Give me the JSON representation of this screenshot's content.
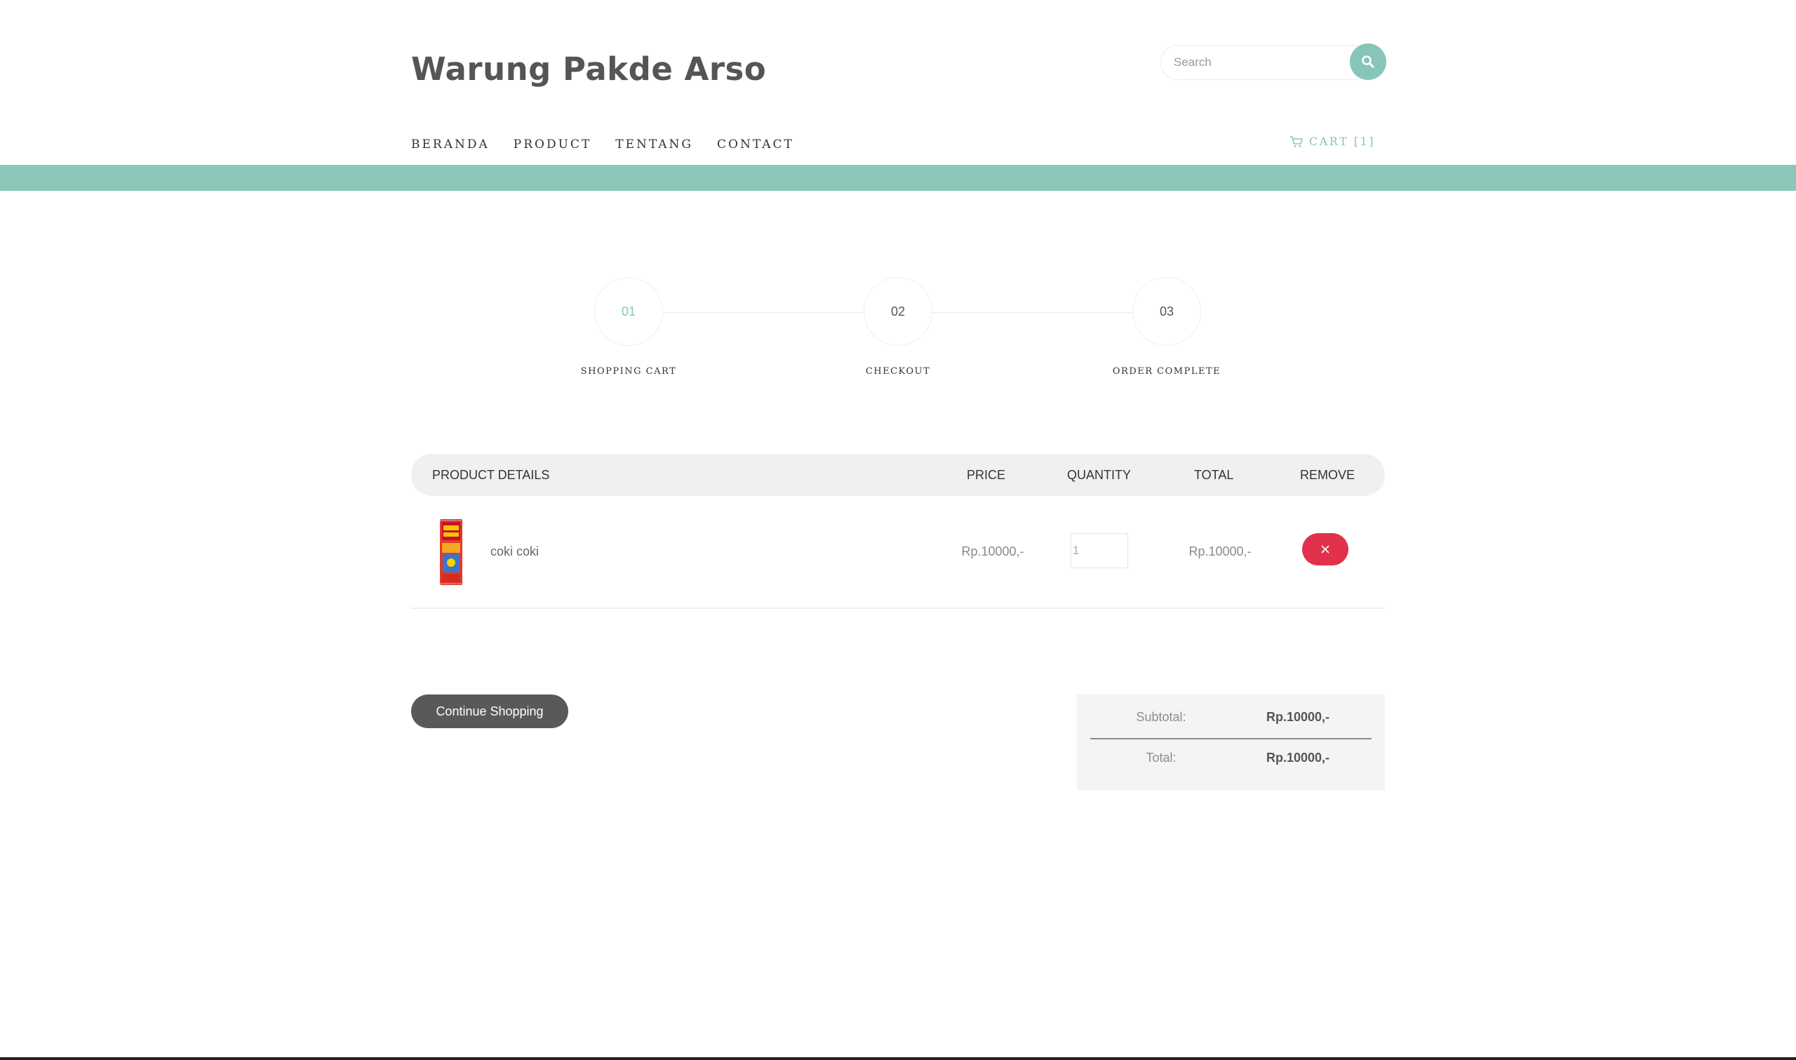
{
  "header": {
    "site_title": "Warung Pakde Arso",
    "search_placeholder": "Search"
  },
  "nav": {
    "items": [
      "BERANDA",
      "PRODUCT",
      "TENTANG",
      "CONTACT"
    ],
    "cart_label": "CART [1]"
  },
  "steps": [
    {
      "number": "01",
      "label": "SHOPPING CART",
      "active": true
    },
    {
      "number": "02",
      "label": "CHECKOUT",
      "active": false
    },
    {
      "number": "03",
      "label": "ORDER COMPLETE",
      "active": false
    }
  ],
  "table": {
    "headers": [
      "PRODUCT DETAILS",
      "PRICE",
      "QUANTITY",
      "TOTAL",
      "REMOVE"
    ],
    "rows": [
      {
        "product_name": "coki coki",
        "price": "Rp.10000,-",
        "quantity": "1",
        "total": "Rp.10000,-"
      }
    ]
  },
  "actions": {
    "continue_label": "Continue Shopping"
  },
  "totals": {
    "subtotal_label": "Subtotal:",
    "subtotal_value": "Rp.10000,-",
    "total_label": "Total:",
    "total_value": "Rp.10000,-"
  },
  "colors": {
    "accent": "#87c5b8",
    "remove": "#e2314a",
    "dark_button": "#595959"
  },
  "icons": {
    "search": "search-icon",
    "cart": "cart-icon",
    "remove": "close-icon"
  }
}
